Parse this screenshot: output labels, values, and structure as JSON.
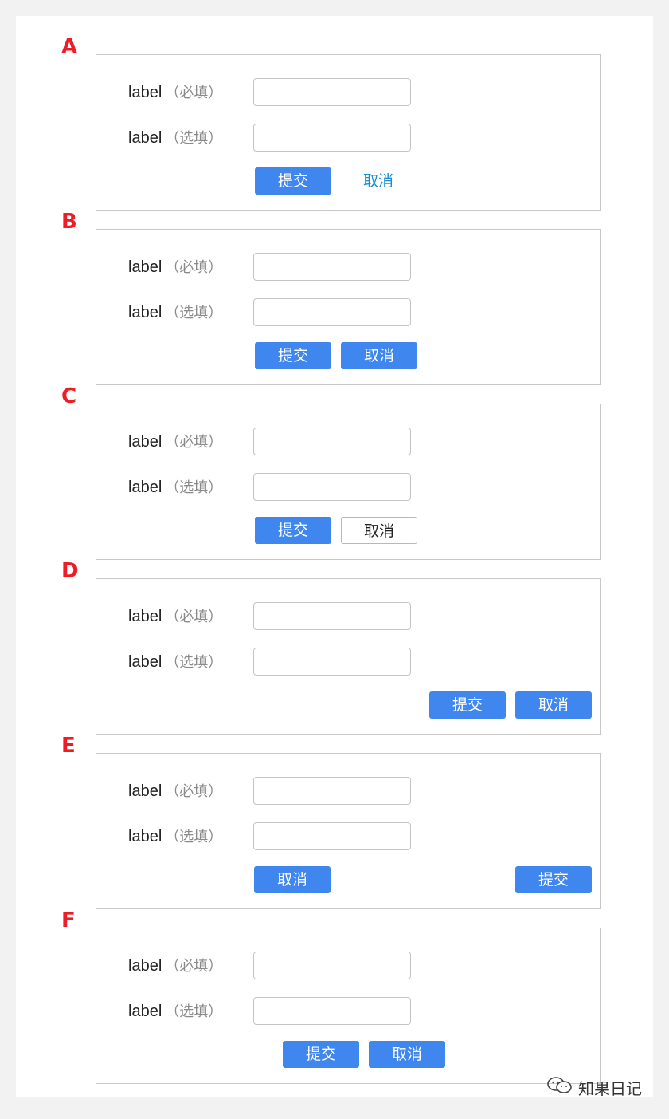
{
  "variants": [
    {
      "letter": "A",
      "field1_label": "label",
      "field1_hint": "（必填）",
      "field2_label": "label",
      "field2_hint": "（选填）",
      "submit": "提交",
      "cancel": "取消"
    },
    {
      "letter": "B",
      "field1_label": "label",
      "field1_hint": "（必填）",
      "field2_label": "label",
      "field2_hint": "（选填）",
      "submit": "提交",
      "cancel": "取消"
    },
    {
      "letter": "C",
      "field1_label": "label",
      "field1_hint": "（必填）",
      "field2_label": "label",
      "field2_hint": "（选填）",
      "submit": "提交",
      "cancel": "取消"
    },
    {
      "letter": "D",
      "field1_label": "label",
      "field1_hint": "（必填）",
      "field2_label": "label",
      "field2_hint": "（选填）",
      "submit": "提交",
      "cancel": "取消"
    },
    {
      "letter": "E",
      "field1_label": "label",
      "field1_hint": "（必填）",
      "field2_label": "label",
      "field2_hint": "（选填）",
      "submit": "提交",
      "cancel": "取消"
    },
    {
      "letter": "F",
      "field1_label": "label",
      "field1_hint": "（必填）",
      "field2_label": "label",
      "field2_hint": "（选填）",
      "submit": "提交",
      "cancel": "取消"
    }
  ],
  "watermark": {
    "icon": "wechat-icon",
    "text": "知果日记"
  },
  "colors": {
    "letter": "#ee1c25",
    "primary": "#3f86ef",
    "link": "#1a8ed4",
    "border": "#c8c8c8",
    "background": "#f2f2f2"
  }
}
